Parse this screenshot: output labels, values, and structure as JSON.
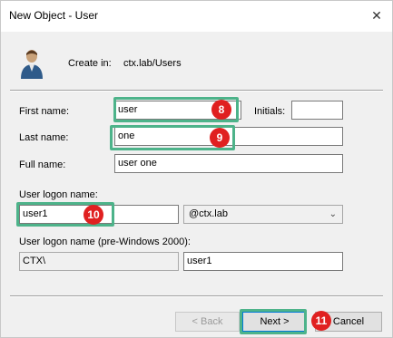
{
  "window": {
    "title": "New Object - User",
    "close_glyph": "✕"
  },
  "header": {
    "create_in_label": "Create in:",
    "create_in_value": "ctx.lab/Users",
    "icon": "user-icon"
  },
  "form": {
    "first_name_label": "First name:",
    "first_name_value": "user",
    "initials_label": "Initials:",
    "initials_value": "",
    "last_name_label": "Last name:",
    "last_name_value": "one",
    "full_name_label": "Full name:",
    "full_name_value": "user one",
    "logon_name_label": "User logon name:",
    "logon_name_value": "user1",
    "domain_value": "@ctx.lab",
    "pre2000_label": "User logon name (pre-Windows 2000):",
    "pre2000_domain_value": "CTX\\",
    "pre2000_name_value": "user1"
  },
  "annotations": {
    "b8": "8",
    "b9": "9",
    "b10": "10",
    "b11": "11",
    "highlight_color": "#4db38a",
    "badge_color": "#e02020"
  },
  "buttons": {
    "back": "< Back",
    "next": "Next >",
    "cancel": "Cancel"
  }
}
